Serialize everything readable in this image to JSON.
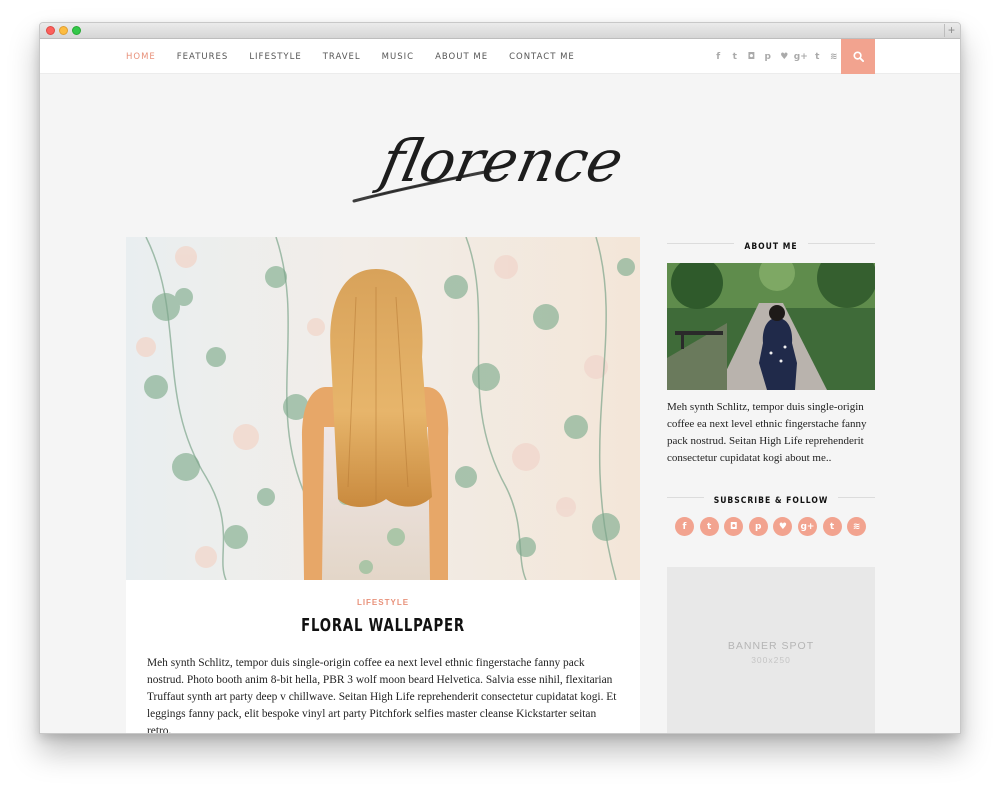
{
  "browser": {
    "controls": [
      "close",
      "minimize",
      "maximize"
    ],
    "new_tab_glyph": "+"
  },
  "nav": {
    "items": [
      {
        "label": "HOME",
        "active": true
      },
      {
        "label": "FEATURES"
      },
      {
        "label": "LIFESTYLE"
      },
      {
        "label": "TRAVEL"
      },
      {
        "label": "MUSIC"
      },
      {
        "label": "ABOUT ME"
      },
      {
        "label": "CONTACT ME"
      }
    ],
    "social_icons": [
      {
        "name": "facebook-icon",
        "glyph": "f"
      },
      {
        "name": "twitter-icon",
        "glyph": "t"
      },
      {
        "name": "instagram-icon",
        "glyph": "◘"
      },
      {
        "name": "pinterest-icon",
        "glyph": "p"
      },
      {
        "name": "bloglovin-heart-icon",
        "glyph": "♥"
      },
      {
        "name": "google-plus-icon",
        "glyph": "g+"
      },
      {
        "name": "tumblr-icon",
        "glyph": "t"
      },
      {
        "name": "rss-icon",
        "glyph": "≋"
      }
    ],
    "search_icon": "search-icon"
  },
  "logo": {
    "text": "florence"
  },
  "post": {
    "category": "LIFESTYLE",
    "title": "FLORAL WALLPAPER",
    "body": "Meh synth Schlitz, tempor duis single-origin coffee ea next level ethnic fingerstache fanny pack nostrud. Photo booth anim 8-bit hella, PBR 3 wolf moon beard Helvetica. Salvia esse nihil, flexitarian Truffaut synth art party deep v chillwave. Seitan High Life reprehenderit consectetur cupidatat kogi. Et leggings fanny pack, elit bespoke vinyl art party Pitchfork selfies master cleanse Kickstarter seitan retro."
  },
  "sidebar": {
    "about": {
      "heading": "ABOUT ME",
      "text": "Meh synth Schlitz, tempor duis single-origin coffee ea next level ethnic fingerstache fanny pack nostrud. Seitan High Life reprehenderit consectetur cupidatat kogi about me.."
    },
    "follow": {
      "heading": "SUBSCRIBE & FOLLOW",
      "icons": [
        {
          "name": "facebook-icon",
          "glyph": "f"
        },
        {
          "name": "twitter-icon",
          "glyph": "t"
        },
        {
          "name": "instagram-icon",
          "glyph": "◘"
        },
        {
          "name": "pinterest-icon",
          "glyph": "p"
        },
        {
          "name": "bloglovin-heart-icon",
          "glyph": "♥"
        },
        {
          "name": "google-plus-icon",
          "glyph": "g+"
        },
        {
          "name": "tumblr-icon",
          "glyph": "t"
        },
        {
          "name": "rss-icon",
          "glyph": "≋"
        }
      ]
    },
    "banner": {
      "title": "BANNER SPOT",
      "size": "300x250"
    }
  },
  "colors": {
    "accent": "#f2a38f",
    "accent_text": "#e8917a",
    "page_bg": "#f5f5f5",
    "card_bg": "#ffffff"
  }
}
